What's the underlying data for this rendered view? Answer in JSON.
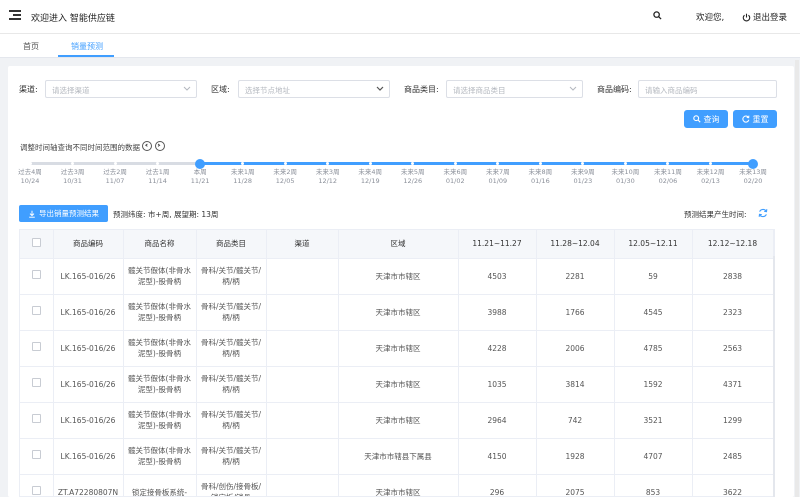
{
  "header": {
    "brand": "欢迎进入 智能供应链",
    "welcome": "欢迎您,",
    "logout": "退出登录"
  },
  "tabs": [
    {
      "label": "首页",
      "active": false
    },
    {
      "label": "销量预测",
      "active": true
    }
  ],
  "filters": {
    "channel": {
      "label": "渠道:",
      "placeholder": "请选择渠道"
    },
    "region": {
      "label": "区域:",
      "placeholder": "选择节点地址"
    },
    "category": {
      "label": "商品类目:",
      "placeholder": "请选择商品类目"
    },
    "code": {
      "label": "商品编码:",
      "placeholder": "请输入商品编码"
    }
  },
  "buttons": {
    "query": "查询",
    "reset": "重置",
    "export": "导出销量预测结果"
  },
  "timeline": {
    "hint": "调整时间轴查询不同时间范围的数据",
    "labels": [
      {
        "top": "过去4周",
        "date": "10/24"
      },
      {
        "top": "过去3周",
        "date": "10/31"
      },
      {
        "top": "过去2周",
        "date": "11/07"
      },
      {
        "top": "过去1周",
        "date": "11/14"
      },
      {
        "top": "本周",
        "date": "11/21"
      },
      {
        "top": "未来1周",
        "date": "11/28"
      },
      {
        "top": "未来2周",
        "date": "12/05"
      },
      {
        "top": "未来3周",
        "date": "12/12"
      },
      {
        "top": "未来4周",
        "date": "12/19"
      },
      {
        "top": "未来5周",
        "date": "12/26"
      },
      {
        "top": "未来6周",
        "date": "01/02"
      },
      {
        "top": "未来7周",
        "date": "01/09"
      },
      {
        "top": "未来8周",
        "date": "01/16"
      },
      {
        "top": "未来9周",
        "date": "01/23"
      },
      {
        "top": "未来10周",
        "date": "01/30"
      },
      {
        "top": "未来11周",
        "date": "02/06"
      },
      {
        "top": "未来12周",
        "date": "02/13"
      },
      {
        "top": "未来13周",
        "date": "02/20"
      }
    ],
    "range_start_index": 4,
    "range_end_index": 17
  },
  "meta": {
    "forecast_info": "预测纬度: 市+周, 展望期: 13周",
    "result_time_label": "预测结果产生时间:"
  },
  "table": {
    "columns": [
      "商品编码",
      "商品名称",
      "商品类目",
      "渠道",
      "区域",
      "11.21~11.27",
      "11.28~12.04",
      "12.05~12.11",
      "12.12~12.18"
    ],
    "rows": [
      {
        "code": "LK.165-016/26",
        "name": "髋关节假体(非骨水泥型)-股骨柄",
        "category": "骨科/关节/髋关节/柄/柄",
        "channel": "",
        "region": "天津市市辖区",
        "w1": "4503",
        "w2": "2281",
        "w3": "59",
        "w4": "2838"
      },
      {
        "code": "LK.165-016/26",
        "name": "髋关节假体(非骨水泥型)-股骨柄",
        "category": "骨科/关节/髋关节/柄/柄",
        "channel": "",
        "region": "天津市市辖区",
        "w1": "3988",
        "w2": "1766",
        "w3": "4545",
        "w4": "2323"
      },
      {
        "code": "LK.165-016/26",
        "name": "髋关节假体(非骨水泥型)-股骨柄",
        "category": "骨科/关节/髋关节/柄/柄",
        "channel": "",
        "region": "天津市市辖区",
        "w1": "4228",
        "w2": "2006",
        "w3": "4785",
        "w4": "2563"
      },
      {
        "code": "LK.165-016/26",
        "name": "髋关节假体(非骨水泥型)-股骨柄",
        "category": "骨科/关节/髋关节/柄/柄",
        "channel": "",
        "region": "天津市市辖区",
        "w1": "1035",
        "w2": "3814",
        "w3": "1592",
        "w4": "4371"
      },
      {
        "code": "LK.165-016/26",
        "name": "髋关节假体(非骨水泥型)-股骨柄",
        "category": "骨科/关节/髋关节/柄/柄",
        "channel": "",
        "region": "天津市市辖区",
        "w1": "2964",
        "w2": "742",
        "w3": "3521",
        "w4": "1299"
      },
      {
        "code": "LK.165-016/26",
        "name": "髋关节假体(非骨水泥型)-股骨柄",
        "category": "骨科/关节/髋关节/柄/柄",
        "channel": "",
        "region": "天津市市辖县下属县",
        "w1": "4150",
        "w2": "1928",
        "w3": "4707",
        "w4": "2485"
      },
      {
        "code": "ZT.A72280807N",
        "name": "锁定接骨板系统-",
        "category": "骨科/创伤/接骨板/锁定板/锁骨",
        "channel": "",
        "region": "天津市市辖区",
        "w1": "296",
        "w2": "2075",
        "w3": "853",
        "w4": "3622"
      }
    ]
  },
  "colors": {
    "accent": "#409eff",
    "track_inactive": "#d8dce3"
  }
}
